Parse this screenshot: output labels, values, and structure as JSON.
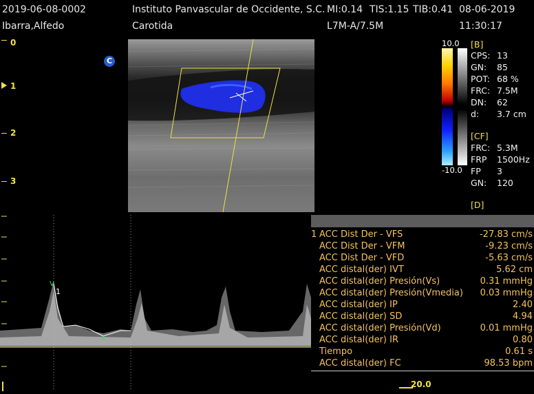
{
  "header": {
    "study_id": "2019-06-08-0002",
    "institution": "Instituto Panvascular de Occidente, S.C.",
    "mi": "MI:0.14",
    "tis": "TIS:1.15",
    "tib": "TIB:0.41",
    "date": "08-06-2019",
    "patient": "Ibarra,Alfedo",
    "exam": "Carotida",
    "probe": "L7M-A/7.5M",
    "time": "11:30:17"
  },
  "depth_scale": [
    "0",
    "1",
    "2",
    "3"
  ],
  "mode_marker": "C",
  "color_bar": {
    "max": "10.0",
    "min": "-10.0"
  },
  "params": {
    "b_section": "[B]",
    "b": [
      {
        "k": "CPS:",
        "v": "13"
      },
      {
        "k": "GN:",
        "v": "85"
      },
      {
        "k": "POT:",
        "v": "68 %"
      },
      {
        "k": "FRC:",
        "v": "7.5M"
      },
      {
        "k": "DN:",
        "v": "62"
      },
      {
        "k": "d:",
        "v": "3.7 cm"
      }
    ],
    "cf_section": "[CF]",
    "cf": [
      {
        "k": "FRC:",
        "v": "5.3M"
      },
      {
        "k": "FRP",
        "v": "1500Hz"
      },
      {
        "k": "FP",
        "v": "3"
      },
      {
        "k": "GN:",
        "v": "120"
      }
    ],
    "d_section": "[D]"
  },
  "measurements": [
    {
      "num": "1",
      "label": "ACC Dist Der - VFS",
      "value": "-27.83 cm/s"
    },
    {
      "num": "",
      "label": "ACC Dist Der - VFM",
      "value": "-9.23 cm/s"
    },
    {
      "num": "",
      "label": "ACC Dist Der - VFD",
      "value": "-5.63 cm/s"
    },
    {
      "num": "",
      "label": "ACC distal(der) IVT",
      "value": "5.62 cm"
    },
    {
      "num": "",
      "label": "ACC distal(der) Presión(Vs)",
      "value": "0.31 mmHg"
    },
    {
      "num": "",
      "label": "ACC distal(der) Presión(Vmedia)",
      "value": "0.03 mmHg"
    },
    {
      "num": "",
      "label": "ACC distal(der) IP",
      "value": "2.40"
    },
    {
      "num": "",
      "label": "ACC distal(der) SD",
      "value": "4.94"
    },
    {
      "num": "",
      "label": "ACC distal(der) Presión(Vd)",
      "value": "0.01 mmHg"
    },
    {
      "num": "",
      "label": "ACC distal(der) IR",
      "value": "0.80"
    },
    {
      "num": "",
      "label": "Tiempo",
      "value": "0.61 s"
    },
    {
      "num": "",
      "label": "ACC distal(der) FC",
      "value": "98.53 bpm"
    }
  ],
  "doppler": {
    "cursor_label": "1",
    "scale_value": "20.0"
  },
  "colors": {
    "yellow": "#f1e04a",
    "orange": "#f5c35b",
    "flow_blue": "#1f2ee0"
  }
}
